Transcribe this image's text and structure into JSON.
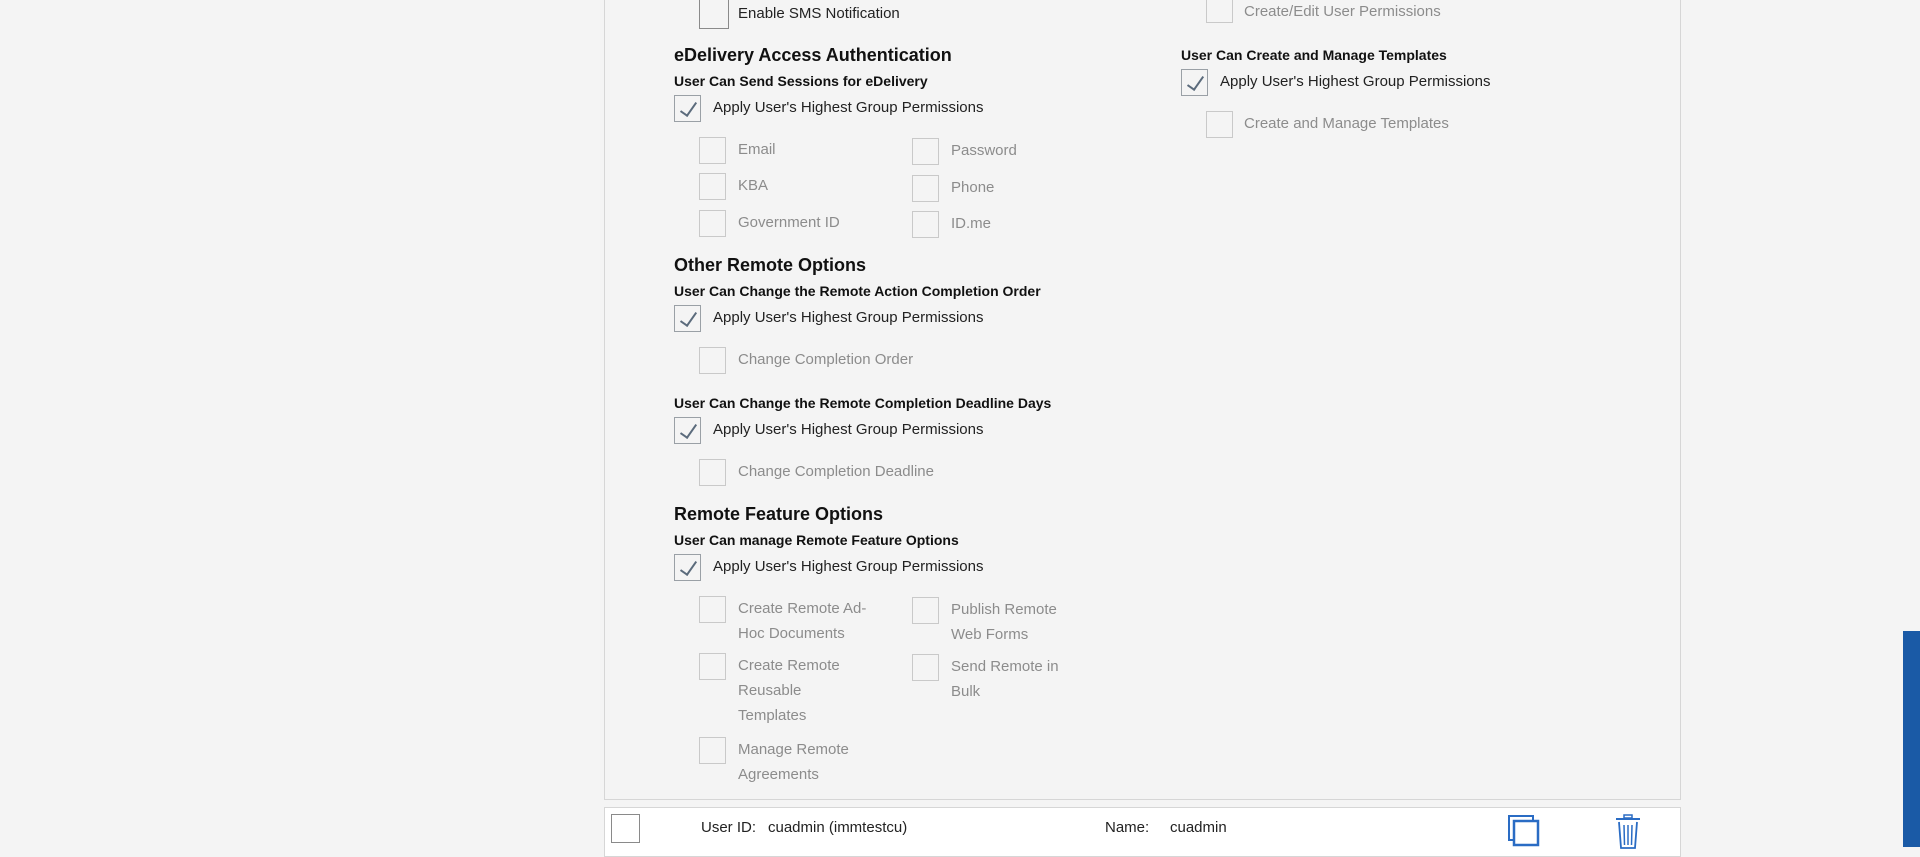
{
  "sms": {
    "label": "Enable SMS Notification"
  },
  "right_top": {
    "label": "Create/Edit User Permissions"
  },
  "edelivery": {
    "title": "eDelivery Access Authentication",
    "subtitle": "User Can Send Sessions for eDelivery",
    "apply_label": "Apply User's Highest Group Permissions",
    "options": [
      "Email",
      "Password",
      "KBA",
      "Phone",
      "Government ID",
      "ID.me"
    ]
  },
  "templates": {
    "subtitle": "User Can Create and Manage Templates",
    "apply_label": "Apply User's Highest Group Permissions",
    "option": "Create and Manage Templates"
  },
  "other_remote": {
    "title": "Other Remote Options",
    "order": {
      "subtitle": "User Can Change the Remote Action Completion Order",
      "apply_label": "Apply User's Highest Group Permissions",
      "option": "Change Completion Order"
    },
    "deadline": {
      "subtitle": "User Can Change the Remote Completion Deadline Days",
      "apply_label": "Apply User's Highest Group Permissions",
      "option": "Change Completion Deadline"
    }
  },
  "remote_feature": {
    "title": "Remote Feature Options",
    "subtitle": "User Can manage Remote Feature Options",
    "apply_label": "Apply User's Highest Group Permissions",
    "options": [
      "Create Remote Ad-Hoc Documents",
      "Publish Remote Web Forms",
      "Create Remote Reusable Templates",
      "Send Remote in Bulk",
      "Manage Remote Agreements"
    ]
  },
  "footer": {
    "userid_label": "User ID:",
    "userid_value": "cuadmin (immtestcu)",
    "name_label": "Name:",
    "name_value": "cuadmin",
    "copy_icon": "copy-icon",
    "trash_icon": "trash-icon"
  },
  "colors": {
    "accent": "#1a5aa6",
    "icon": "#2a6cc4"
  }
}
